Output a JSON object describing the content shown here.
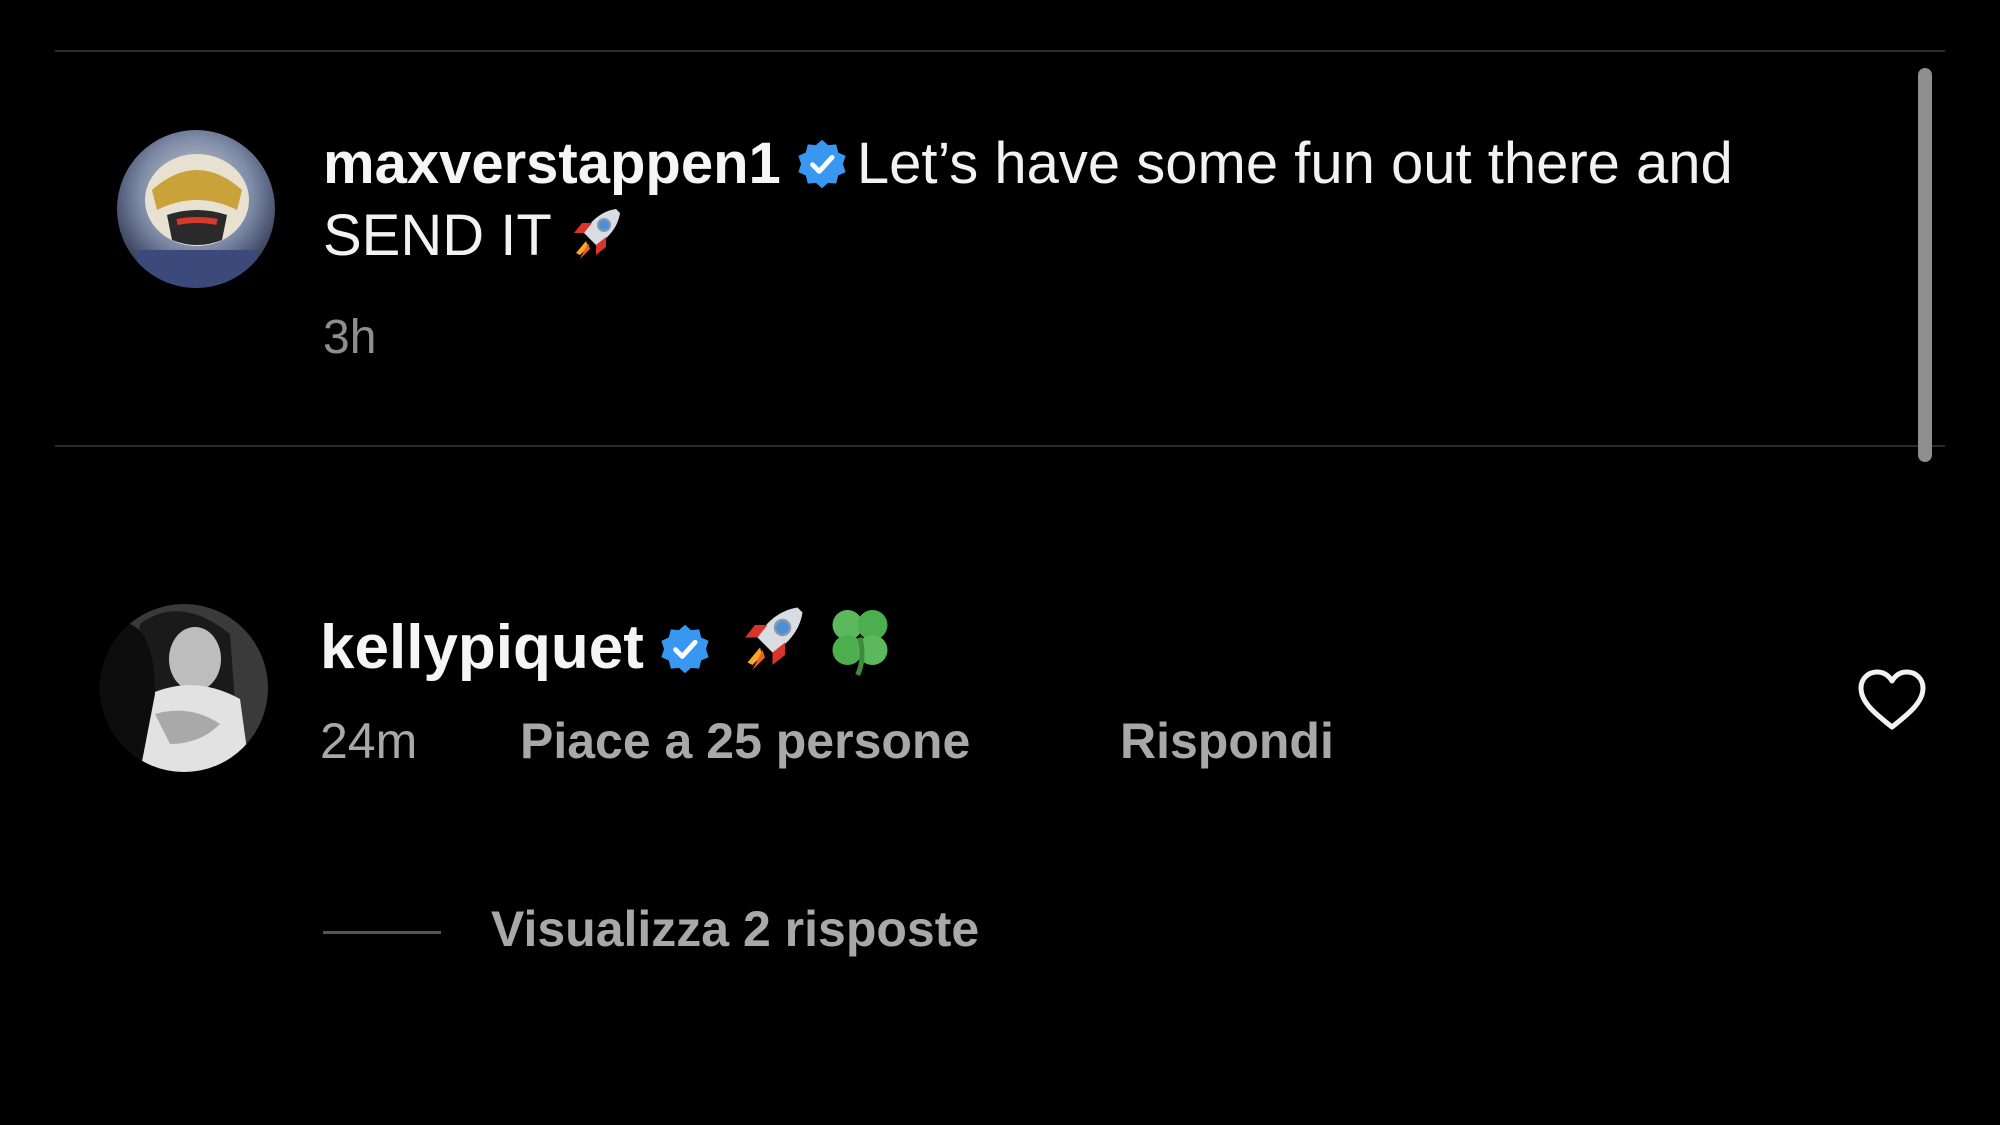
{
  "post": {
    "username": "maxverstappen1",
    "caption": "Let’s have some fun out there and SEND IT",
    "caption_emoji": "rocket-emoji",
    "time": "3h"
  },
  "comment": {
    "username": "kellypiquet",
    "emojis": [
      "rocket-emoji",
      "four-leaf-clover-emoji"
    ],
    "time": "24m",
    "likes": "Piace a 25 persone",
    "reply": "Rispondi",
    "view_replies": "Visualizza 2 risposte"
  },
  "colors": {
    "background": "#000000",
    "verified_badge": "#3897f0",
    "secondary_text": "#a8a8a8"
  }
}
